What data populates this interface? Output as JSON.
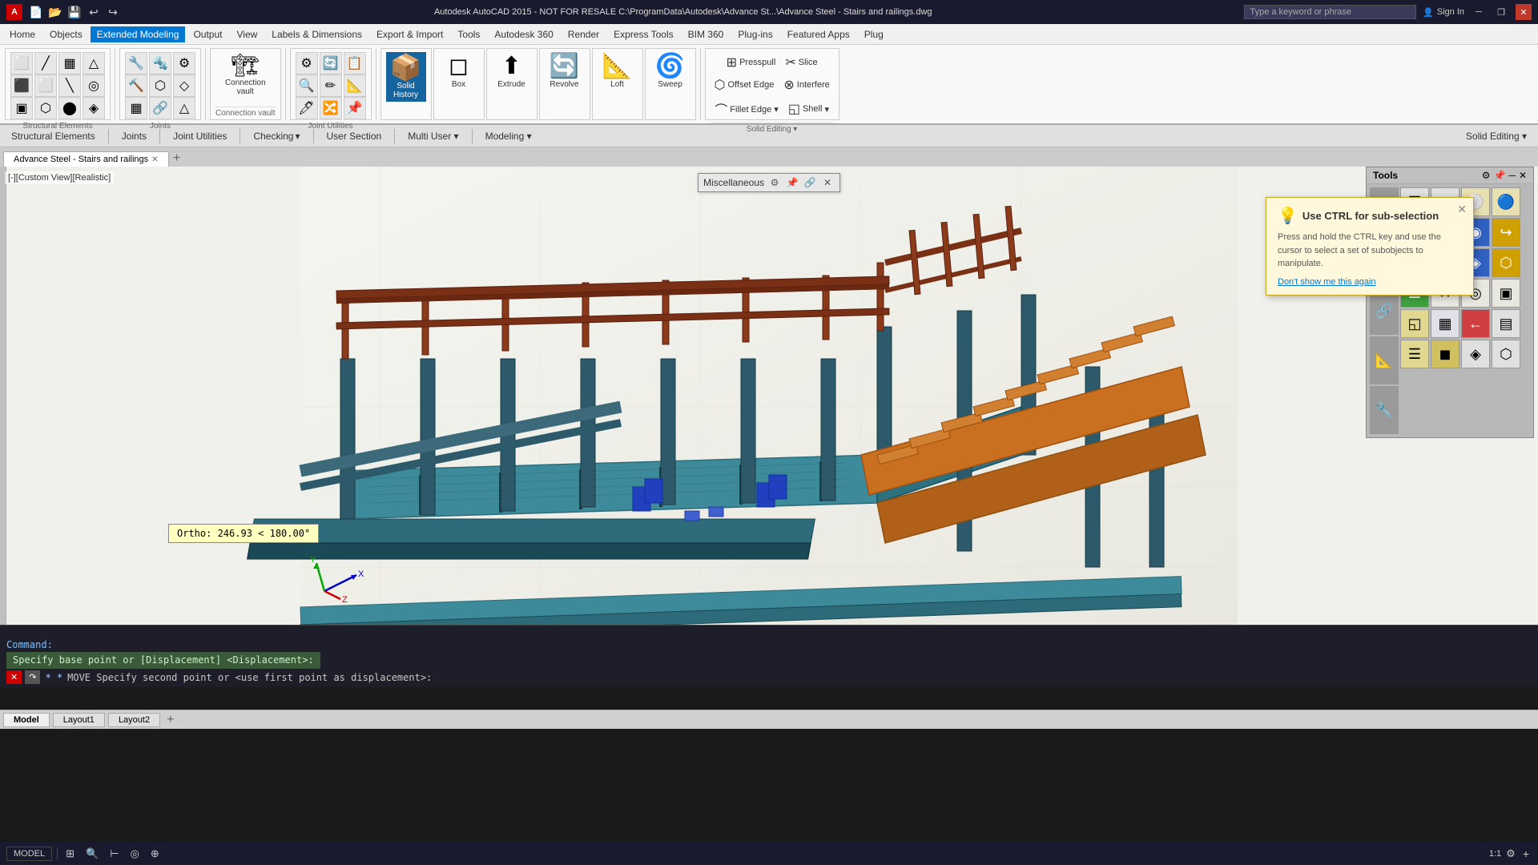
{
  "titlebar": {
    "title": "Autodesk AutoCAD 2015 - NOT FOR RESALE  C:\\ProgramData\\Autodesk\\Advance St...\\Advance Steel - Stairs and railings.dwg",
    "search_placeholder": "Type a keyword or phrase",
    "sign_in": "Sign In",
    "win_minimize": "─",
    "win_restore": "❐",
    "win_close": "✕"
  },
  "menubar": {
    "items": [
      "Home",
      "Objects",
      "Extended Modeling",
      "Output",
      "View",
      "Labels & Dimensions",
      "Export & Import",
      "Tools",
      "Autodesk 360",
      "Render",
      "Express Tools",
      "BIM 360",
      "Plug-ins",
      "Featured Apps",
      "Plug"
    ]
  },
  "ribbon": {
    "panels": [
      {
        "name": "Structural Elements",
        "buttons": []
      },
      {
        "name": "Joints",
        "buttons": []
      },
      {
        "name": "Connection vault",
        "label": "Connection\nvault",
        "icon": "🔩",
        "buttons": []
      },
      {
        "name": "Joint Utilities",
        "buttons": []
      },
      {
        "name": "Checking",
        "buttons": [
          "Checking ▾"
        ]
      },
      {
        "name": "User Section",
        "buttons": []
      },
      {
        "name": "Multi User",
        "buttons": [
          "Multi User ▾"
        ]
      },
      {
        "name": "Modeling",
        "buttons": [
          "Modeling ▾"
        ]
      },
      {
        "name": "Solid History",
        "label": "Solid History",
        "icon": "📦",
        "highlighted": true
      },
      {
        "name": "Box",
        "icon": "◻",
        "label": "Box"
      },
      {
        "name": "Extrude",
        "icon": "⬆",
        "label": "Extrude"
      },
      {
        "name": "Revolve",
        "icon": "🔄",
        "label": "Revolve"
      },
      {
        "name": "Loft",
        "icon": "📐",
        "label": "Loft"
      },
      {
        "name": "Sweep",
        "icon": "🌀",
        "label": "Sweep"
      },
      {
        "name": "Solid Editing",
        "buttons": [
          "Solid Editing ▾"
        ]
      }
    ],
    "sub_buttons": {
      "row1": [
        "Presspull",
        "Slice",
        "Offset Edge",
        "Interfere",
        "Fillet Edge ▾",
        "Shell ▾"
      ],
      "row2": []
    }
  },
  "checking_menu": {
    "label": "Checking",
    "arrow": "▾"
  },
  "shell": {
    "label": "Shell",
    "arrow": "▾"
  },
  "tooltip": {
    "title": "Use CTRL for sub-selection",
    "body": "Press and hold the CTRL key and use the cursor to select a set of subobjects to manipulate.",
    "dismiss": "Don't show me this again"
  },
  "misc_toolbar": {
    "label": "Miscellaneous",
    "buttons": [
      "⚙",
      "📌",
      "🔗",
      "✕"
    ]
  },
  "tools_panel": {
    "title": "Tools",
    "close": "✕",
    "minimize": "─",
    "settings": "⚙",
    "pin": "📌"
  },
  "doc_tab": {
    "name": "Advance Steel - Stairs and railings",
    "active": true
  },
  "view_label": "[-][Custom View][Realistic]",
  "ortho_tooltip": "Ortho: 246.93 < 180.00°",
  "cmdline": {
    "prompt_text": "Specify base point or [Displacement] <Displacement>:",
    "command_line": "MOVE  Specify second point or <use first point as displacement>:",
    "prefix": "* *"
  },
  "statusbar": {
    "model_tab": "MODEL",
    "zoom": "1:1",
    "tabs": [
      "Model",
      "Layout1",
      "Layout2"
    ]
  },
  "bottom_tabs": [
    "Model",
    "Layout1",
    "Layout2"
  ]
}
